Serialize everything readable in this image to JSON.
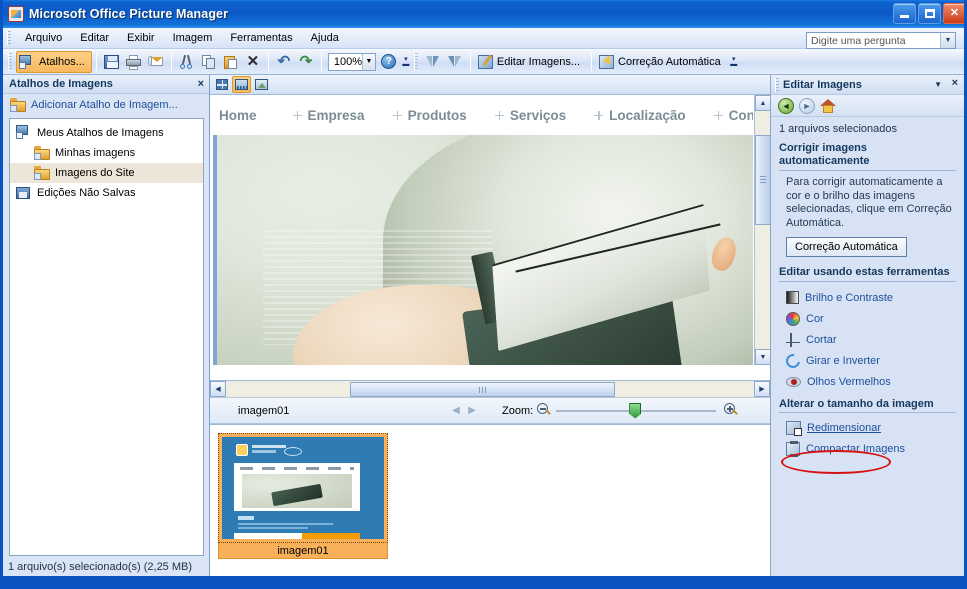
{
  "window": {
    "title": "Microsoft Office Picture Manager",
    "icon": "picture-manager-icon",
    "minimize_label": "Minimizar",
    "maximize_label": "Maximizar",
    "close_label": "Fechar"
  },
  "menu": {
    "items": [
      {
        "label": "Arquivo"
      },
      {
        "label": "Editar"
      },
      {
        "label": "Exibir"
      },
      {
        "label": "Imagem"
      },
      {
        "label": "Ferramentas"
      },
      {
        "label": "Ajuda"
      }
    ]
  },
  "question_box": {
    "placeholder": "Digite uma pergunta",
    "value": "Digite uma pergunta"
  },
  "toolbar": {
    "shortcuts_label": "Atalhos...",
    "save_label": "Salvar",
    "print_label": "Imprimir",
    "mail_label": "Email",
    "cut_label": "Recortar",
    "copy_label": "Copiar",
    "paste_label": "Colar",
    "delete_label": "Excluir",
    "undo_label": "Desfazer",
    "redo_label": "Refazer",
    "zoom_value": "100%",
    "help_label": "Ajuda",
    "rotate_left_label": "Girar à esquerda",
    "rotate_right_label": "Girar à direita",
    "edit_images_label": "Editar Imagens...",
    "auto_correct_label": "Correção Automática"
  },
  "left_pane": {
    "title": "Atalhos de Imagens",
    "close_label": "×",
    "add_shortcut_label": "Adicionar Atalho de Imagem...",
    "tree": [
      {
        "label": "Meus Atalhos de Imagens",
        "level": 1,
        "selected": false,
        "icon": "shortcuts-icon"
      },
      {
        "label": "Minhas imagens",
        "level": 2,
        "selected": false,
        "icon": "folder-shortcut-icon"
      },
      {
        "label": "Imagens do Site",
        "level": 2,
        "selected": true,
        "icon": "folder-shortcut-icon"
      },
      {
        "label": "Edições Não Salvas",
        "level": 1,
        "selected": false,
        "icon": "unsaved-edits-icon"
      }
    ],
    "status": "1 arquivo(s) selecionado(s) (2,25 MB)"
  },
  "center_pane": {
    "view_buttons": [
      {
        "name": "thumbnail-view",
        "active": false
      },
      {
        "name": "filmstrip-view",
        "active": true
      },
      {
        "name": "single-picture-view",
        "active": false
      }
    ],
    "web_nav_links": [
      {
        "label": "Home",
        "has_bullet": false
      },
      {
        "label": "Empresa",
        "has_bullet": true
      },
      {
        "label": "Produtos",
        "has_bullet": true
      },
      {
        "label": "Serviços",
        "has_bullet": true
      },
      {
        "label": "Localização",
        "has_bullet": true
      },
      {
        "label": "Contat",
        "has_bullet": true
      }
    ],
    "file_name": "imagem01",
    "zoom_label": "Zoom:",
    "zoom_out_label": "Reduzir",
    "zoom_in_label": "Ampliar",
    "prev_label": "Anterior",
    "next_label": "Próxima",
    "thumbnail": {
      "label": "imagem01",
      "selected": true
    }
  },
  "right_pane": {
    "title": "Editar Imagens",
    "chevron_label": "▼",
    "close_label": "×",
    "nav": {
      "back_label": "Voltar",
      "forward_label": "Avançar",
      "home_label": "Início"
    },
    "files_selected": "1 arquivos selecionados",
    "auto_section": {
      "heading": "Corrigir imagens automaticamente",
      "description": "Para corrigir automaticamente a cor e o brilho das imagens selecionadas, clique em Correção Automática.",
      "button_label": "Correção Automática"
    },
    "tools_section": {
      "heading": "Editar usando estas ferramentas",
      "tools": [
        {
          "label": "Brilho e Contraste",
          "icon": "brightness-contrast-icon"
        },
        {
          "label": "Cor",
          "icon": "color-wheel-icon"
        },
        {
          "label": "Cortar",
          "icon": "crop-icon"
        },
        {
          "label": "Girar e Inverter",
          "icon": "rotate-flip-icon"
        },
        {
          "label": "Olhos Vermelhos",
          "icon": "red-eye-icon"
        }
      ]
    },
    "size_section": {
      "heading": "Alterar o tamanho da imagem",
      "items": [
        {
          "label": "Redimensionar",
          "icon": "resize-icon",
          "highlighted": true
        },
        {
          "label": "Compactar Imagens",
          "icon": "compress-icon",
          "highlighted": false
        }
      ]
    }
  },
  "colors": {
    "titlebar_blue": "#0c59c6",
    "accent_orange": "#f8b05a",
    "highlight_red": "#d81111",
    "link_blue": "#1f4f9c",
    "pane_bg": "#d7e3f4"
  }
}
